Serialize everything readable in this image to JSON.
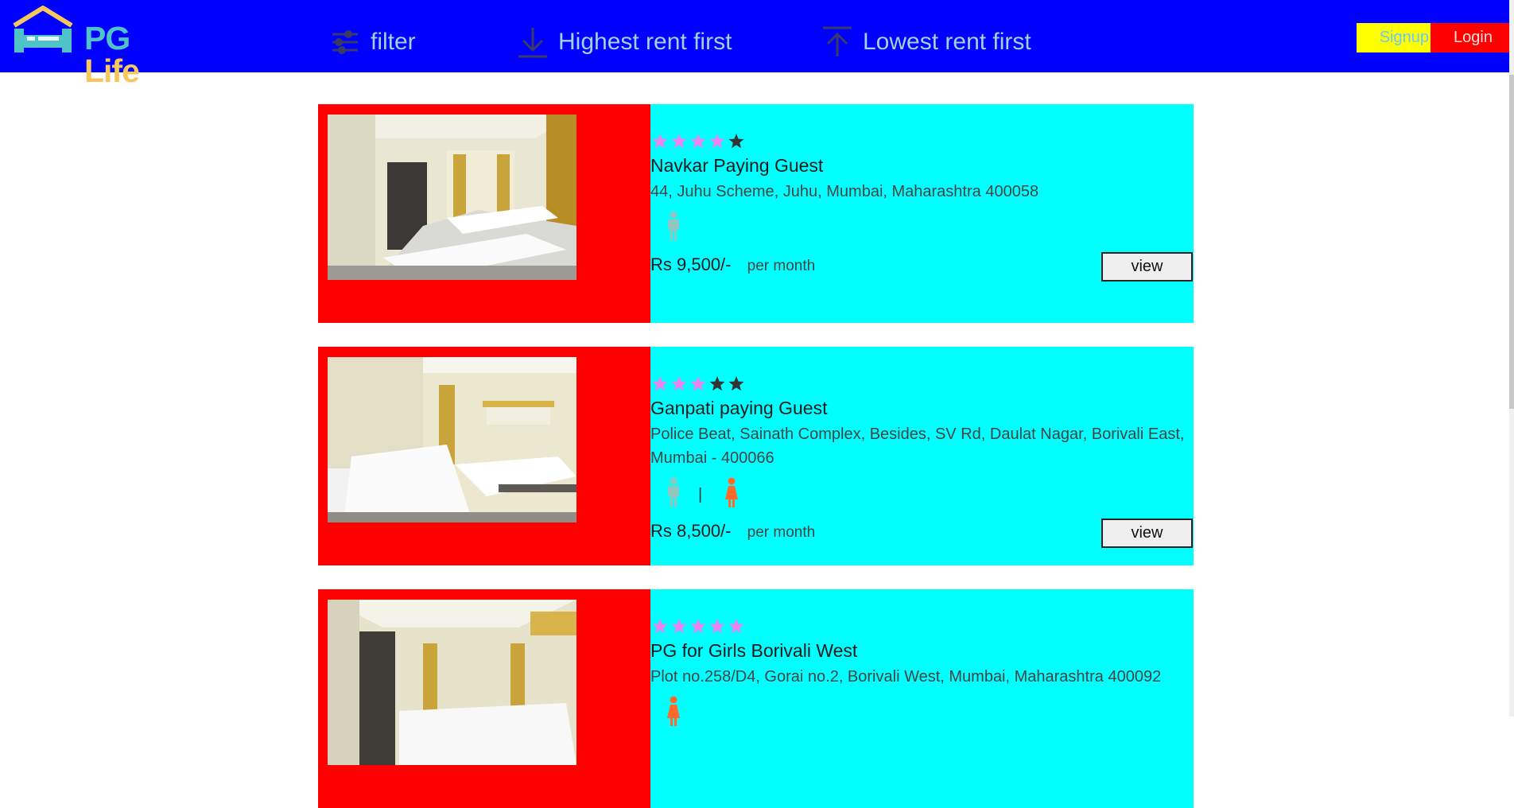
{
  "header": {
    "logo": {
      "part1": "PG",
      "part2": "Life"
    },
    "nav": {
      "filter": "filter",
      "highest": "Highest rent first",
      "lowest": "Lowest rent first"
    },
    "signup": "Signup",
    "login": "Login"
  },
  "colors": {
    "navbar": "#0000ff",
    "card_left": "#ff0000",
    "card_right": "#00ffff",
    "star_filled": "#ee82ee",
    "star_empty": "#333333",
    "male_icon": "#8fc6c0",
    "female_icon": "#ff6a2b"
  },
  "listings": [
    {
      "name": "Navkar Paying Guest",
      "address": "44, Juhu Scheme, Juhu, Mumbai, Maharashtra 400058",
      "rating": 4,
      "genders": [
        "male"
      ],
      "rent": "Rs 9,500/-",
      "per": "per month",
      "view": "view"
    },
    {
      "name": "Ganpati paying Guest",
      "address": "Police Beat, Sainath Complex, Besides, SV Rd, Daulat Nagar, Borivali East, Mumbai - 400066",
      "rating": 3,
      "genders": [
        "male",
        "female"
      ],
      "gender_separator": "|",
      "rent": "Rs 8,500/-",
      "per": "per month",
      "view": "view"
    },
    {
      "name": "PG for Girls Borivali West",
      "address": "Plot no.258/D4, Gorai no.2, Borivali West, Mumbai, Maharashtra 400092",
      "rating": 5,
      "genders": [
        "female"
      ]
    }
  ]
}
